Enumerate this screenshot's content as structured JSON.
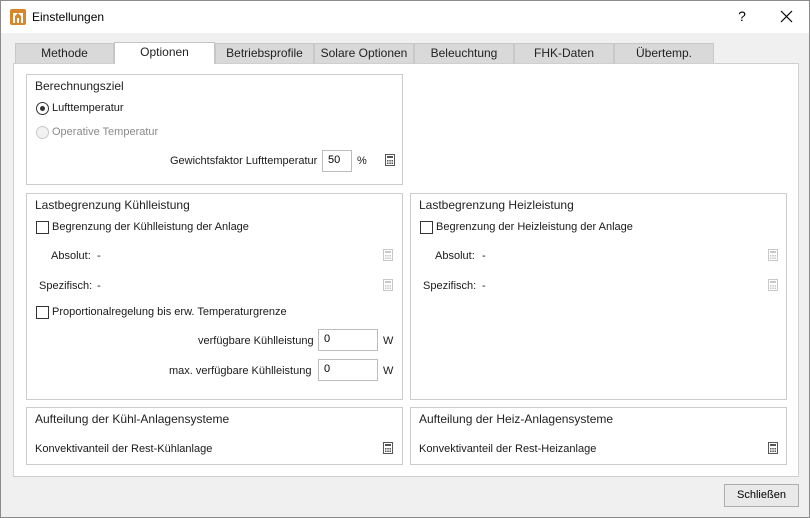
{
  "window": {
    "title": "Einstellungen",
    "help": "?"
  },
  "tabs": [
    "Methode",
    "Optionen",
    "Betriebsprofile",
    "Solare Optionen",
    "Beleuchtung",
    "FHK-Daten",
    "Übertemp."
  ],
  "active_tab": "Optionen",
  "berechnungsziel": {
    "title": "Berechnungsziel",
    "option1": "Lufttemperatur",
    "option2": "Operative Temperatur",
    "factor_label": "Gewichtsfaktor Lufttemperatur",
    "factor_value": "50",
    "factor_unit": "%"
  },
  "kuehl": {
    "title": "Lastbegrenzung Kühlleistung",
    "checkbox_label": "Begrenzung der Kühlleistung der Anlage",
    "absolut_label": "Absolut:",
    "absolut_value": "-",
    "spezifisch_label": "Spezifisch:",
    "spezifisch_value": "-",
    "prop_label": "Proportionalregelung bis erw. Temperaturgrenze",
    "verf_label": "verfügbare Kühlleistung",
    "verf_value": "0",
    "verf_unit": "W",
    "max_label": "max. verfügbare Kühlleistung",
    "max_value": "0",
    "max_unit": "W"
  },
  "heiz": {
    "title": "Lastbegrenzung Heizleistung",
    "checkbox_label": "Begrenzung der Heizleistung der Anlage",
    "absolut_label": "Absolut:",
    "absolut_value": "-",
    "spezifisch_label": "Spezifisch:",
    "spezifisch_value": "-"
  },
  "aufteilung_kuehl": {
    "title": "Aufteilung der Kühl-Anlagensysteme",
    "label": "Konvektivanteil der Rest-Kühlanlage"
  },
  "aufteilung_heiz": {
    "title": "Aufteilung der Heiz-Anlagensysteme",
    "label": "Konvektivanteil der Rest-Heizanlage"
  },
  "buttons": {
    "close": "Schließen"
  },
  "colors": {
    "icon_orange": "#d8862a",
    "disabled": "#8a8a8a"
  }
}
